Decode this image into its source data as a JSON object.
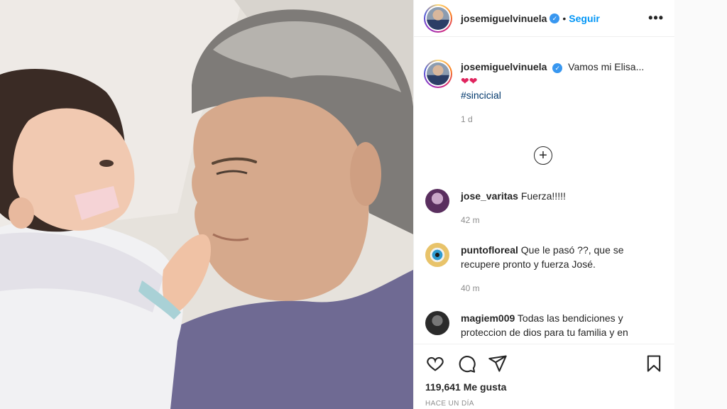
{
  "post": {
    "username": "josemiguelvinuela",
    "follow_label": "Seguir",
    "more_label": "•••"
  },
  "caption": {
    "username": "josemiguelvinuela",
    "text": "Vamos mi Elisa...",
    "emojis": "❤❤",
    "hashtag": "#sincicial",
    "age": "1 d"
  },
  "load_more_label": "+",
  "comments": [
    {
      "username": "jose_varitas",
      "text": "Fuerza!!!!!",
      "age": "42 m"
    },
    {
      "username": "puntofloreal",
      "text": "Que le pasó ??, que se recupere pronto y fuerza José.",
      "age": "40 m"
    },
    {
      "username": "magiem009",
      "text": "Todas las bendiciones y proteccion de dios para tu familia y en",
      "age": ""
    }
  ],
  "actions": {
    "likes": "119,641 Me gusta",
    "timestamp": "HACE UN DÍA"
  },
  "colors": {
    "accent": "#0095f6",
    "verified": "#3897f0",
    "heart": "#e0245e"
  },
  "icons": [
    "like-icon",
    "comment-icon",
    "share-icon",
    "save-icon",
    "add-circle-icon",
    "verified-icon"
  ]
}
